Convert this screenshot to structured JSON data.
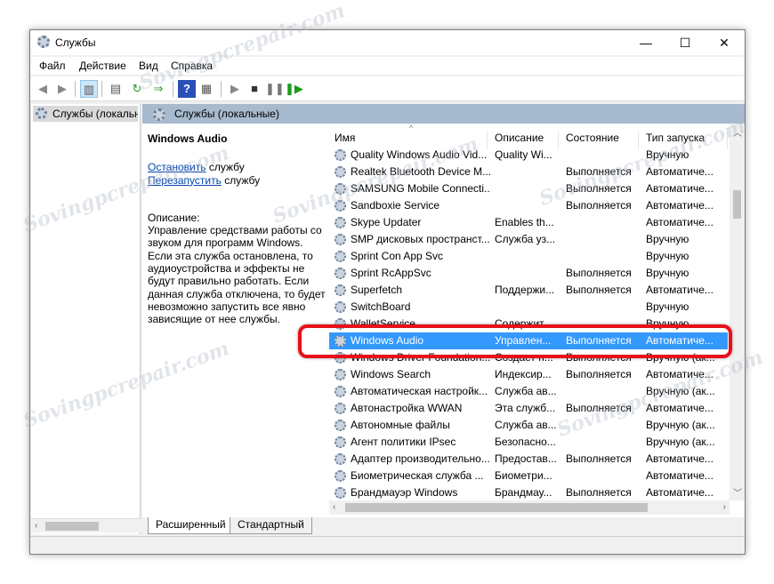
{
  "window": {
    "title": "Службы",
    "minimize": "—",
    "maximize": "☐",
    "close": "✕"
  },
  "menu": [
    "Файл",
    "Действие",
    "Вид",
    "Справка"
  ],
  "tree": {
    "item": "Службы (локальные)"
  },
  "pane": {
    "title": "Службы (локальные)"
  },
  "details": {
    "service_name": "Windows Audio",
    "stop_link": "Остановить",
    "stop_suffix": " службу",
    "restart_link": "Перезапустить",
    "restart_suffix": " службу",
    "desc_label": "Описание:",
    "desc_text": "Управление средствами работы со звуком для программ Windows. Если эта служба остановлена, то аудиоустройства и эффекты не будут правильно работать.  Если данная служба отключена, то будет невозможно запустить все явно зависящие от нее службы."
  },
  "columns": [
    "Имя",
    "Описание",
    "Состояние",
    "Тип запуска"
  ],
  "rows": [
    [
      "Quality Windows Audio Vid...",
      "Quality Wi...",
      "",
      "Вручную"
    ],
    [
      "Realtek Bluetooth Device M...",
      "",
      "Выполняется",
      "Автоматиче..."
    ],
    [
      "SAMSUNG Mobile Connecti...",
      "",
      "Выполняется",
      "Автоматиче..."
    ],
    [
      "Sandboxie Service",
      "",
      "Выполняется",
      "Автоматиче..."
    ],
    [
      "Skype Updater",
      "Enables th...",
      "",
      "Автоматиче..."
    ],
    [
      "SMP дисковых пространст...",
      "Служба уз...",
      "",
      "Вручную"
    ],
    [
      "Sprint Con App Svc",
      "",
      "",
      "Вручную"
    ],
    [
      "Sprint RcAppSvc",
      "",
      "Выполняется",
      "Вручную"
    ],
    [
      "Superfetch",
      "Поддержи...",
      "Выполняется",
      "Автоматиче..."
    ],
    [
      "SwitchBoard",
      "",
      "",
      "Вручную"
    ],
    [
      "WalletService",
      "Содержит...",
      "",
      "Вручную"
    ],
    [
      "Windows Audio",
      "Управлен...",
      "Выполняется",
      "Автоматиче..."
    ],
    [
      "Windows Driver Foundation...",
      "Создает п...",
      "Выполняется",
      "Вручную (ак..."
    ],
    [
      "Windows Search",
      "Индексир...",
      "Выполняется",
      "Автоматиче..."
    ],
    [
      "Автоматическая настройк...",
      "Служба ав...",
      "",
      "Вручную (ак..."
    ],
    [
      "Автонастройка WWAN",
      "Эта служб...",
      "Выполняется",
      "Автоматиче..."
    ],
    [
      "Автономные файлы",
      "Служба ав...",
      "",
      "Вручную (ак..."
    ],
    [
      "Агент политики IPsec",
      "Безопасно...",
      "",
      "Вручную (ак..."
    ],
    [
      "Адаптер производительно...",
      "Предостав...",
      "Выполняется",
      "Автоматиче..."
    ],
    [
      "Биометрическая служба ...",
      "Биометри...",
      "",
      "Автоматиче..."
    ],
    [
      "Брандмауэр Windows",
      "Брандмау...",
      "Выполняется",
      "Автоматиче..."
    ]
  ],
  "selected_index": 11,
  "tabs": [
    "Расширенный",
    "Стандартный"
  ],
  "watermark": "Sovingpcrepair.com",
  "colors": {
    "selection": "#3399ff",
    "highlight": "#e8101a",
    "band": "#a7bace"
  }
}
